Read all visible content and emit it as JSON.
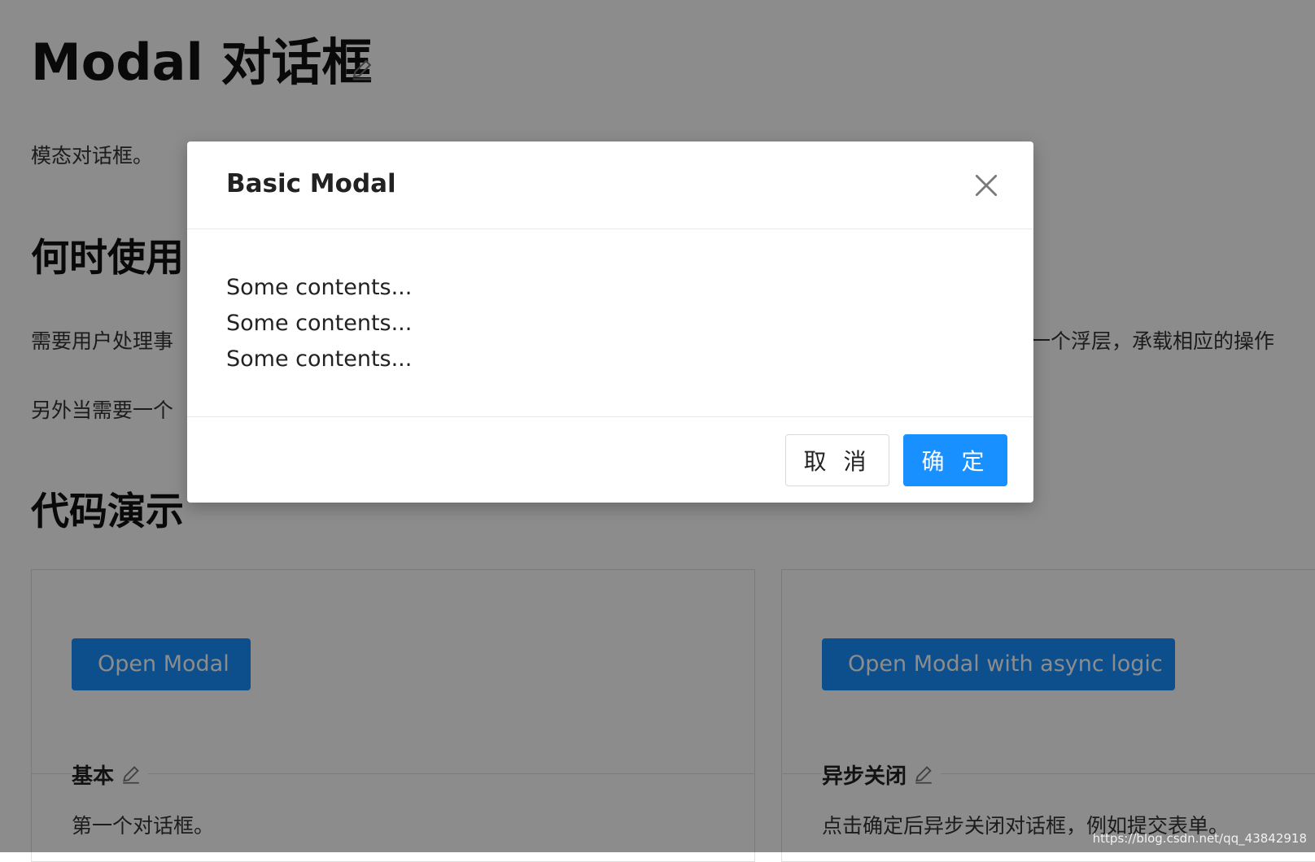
{
  "page": {
    "title": "Modal 对话框",
    "intro": "模态对话框。",
    "when_heading": "何时使用",
    "when_paragraph_visible": "需要用户处理事",
    "when_paragraph_right": "一个浮层，承载相应的操作",
    "another_paragraph_visible": "另外当需要一个",
    "demo_heading": "代码演示"
  },
  "demos": {
    "basic": {
      "button_label": "Open Modal",
      "title": "基本",
      "description": "第一个对话框。"
    },
    "async": {
      "button_label": "Open Modal with async logic",
      "title": "异步关闭",
      "description": "点击确定后异步关闭对话框，例如提交表单。"
    }
  },
  "modal": {
    "title": "Basic Modal",
    "lines": [
      "Some contents...",
      "Some contents...",
      "Some contents..."
    ],
    "cancel_label": "取 消",
    "ok_label": "确 定"
  },
  "watermark": {
    "text": "https://blog.csdn.net/qq_43842918"
  },
  "icons": {
    "edit": "edit-icon",
    "close": "close-icon"
  },
  "colors": {
    "primary": "#1890ff",
    "mask": "rgba(0,0,0,0.45)"
  }
}
